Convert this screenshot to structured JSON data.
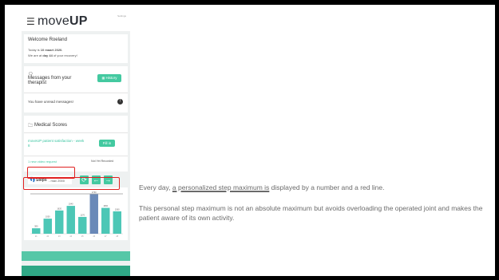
{
  "app": {
    "menu_icon": "hamburger-icon",
    "logo_light": "move",
    "logo_bold": "UP",
    "corner_tiny": "Settings"
  },
  "welcome": {
    "greeting": "Welcome Roeland",
    "today_prefix": "Today is ",
    "today_date": "10 maart 2020.",
    "recovery_prefix": "We are at ",
    "recovery_day": "day 44",
    "recovery_suffix": " of your recovery!"
  },
  "messages": {
    "icon": "chat-icon",
    "title": "Messages from your therapist",
    "history_label": "History",
    "unread_text": "You have unread messages!",
    "unread_badge": "!"
  },
  "medical": {
    "icon": "folder-icon",
    "title": "Medical Scores",
    "survey_label": "moveUP patient satisfaction - week 8",
    "fill_label": "Fill in",
    "video_label": "1 new video request",
    "video_status": "Not Yet Recorded"
  },
  "steps": {
    "icon": "steps-icon",
    "label": "Steps",
    "max_label": "- max 2000",
    "refresh_icon": "refresh-icon",
    "prev_icon": "arrow-left-icon",
    "next_icon": "arrow-right-icon"
  },
  "chart_data": {
    "type": "bar",
    "categories": [
      "d1",
      "d2",
      "d3",
      "d4",
      "d5",
      "d6",
      "d7",
      "d8"
    ],
    "values": [
      380,
      1050,
      1620,
      1940,
      1170,
      2760,
      1800,
      1560
    ],
    "data_labels": [
      "380",
      "1050",
      "1620",
      "1940",
      "1170",
      "2760",
      "1800",
      "1560"
    ],
    "max_line": 2000,
    "ylim": [
      0,
      3000
    ],
    "colors": {
      "accent": "#4cc7b6",
      "highlight": "#6a89b8"
    }
  },
  "annotation": {
    "line1_prefix": "Every day, ",
    "line1_highlight": "a personalized step maximum is",
    "line1_suffix": " displayed by a number and a red line.",
    "para2": "This personal step maximum is not an absolute maximum but avoids overloading the operated joint and makes the patient aware of its own activity."
  },
  "colors": {
    "brand_green": "#43c9a0",
    "alert_red": "#e02020"
  }
}
